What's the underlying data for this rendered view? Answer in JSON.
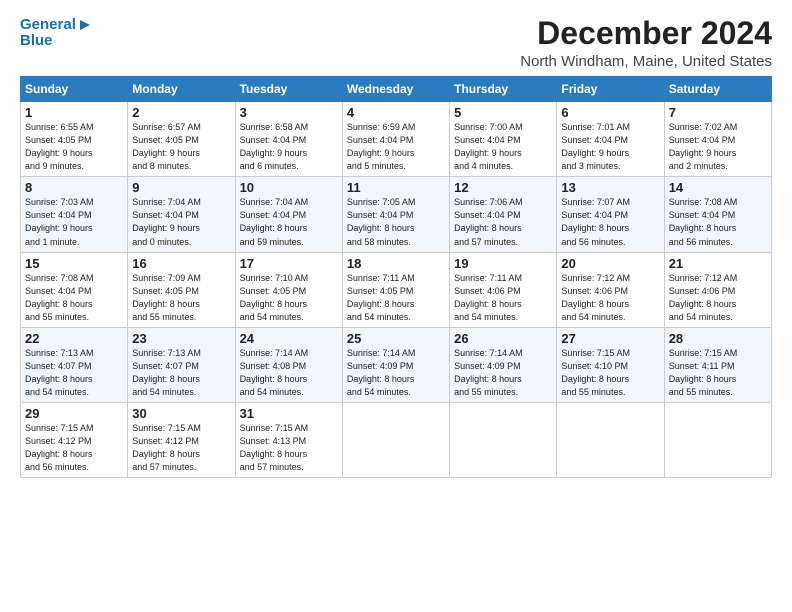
{
  "logo": {
    "line1": "General",
    "line2": "Blue"
  },
  "title": "December 2024",
  "location": "North Windham, Maine, United States",
  "days_of_week": [
    "Sunday",
    "Monday",
    "Tuesday",
    "Wednesday",
    "Thursday",
    "Friday",
    "Saturday"
  ],
  "weeks": [
    [
      {
        "day": "1",
        "lines": [
          "Sunrise: 6:55 AM",
          "Sunset: 4:05 PM",
          "Daylight: 9 hours",
          "and 9 minutes."
        ]
      },
      {
        "day": "2",
        "lines": [
          "Sunrise: 6:57 AM",
          "Sunset: 4:05 PM",
          "Daylight: 9 hours",
          "and 8 minutes."
        ]
      },
      {
        "day": "3",
        "lines": [
          "Sunrise: 6:58 AM",
          "Sunset: 4:04 PM",
          "Daylight: 9 hours",
          "and 6 minutes."
        ]
      },
      {
        "day": "4",
        "lines": [
          "Sunrise: 6:59 AM",
          "Sunset: 4:04 PM",
          "Daylight: 9 hours",
          "and 5 minutes."
        ]
      },
      {
        "day": "5",
        "lines": [
          "Sunrise: 7:00 AM",
          "Sunset: 4:04 PM",
          "Daylight: 9 hours",
          "and 4 minutes."
        ]
      },
      {
        "day": "6",
        "lines": [
          "Sunrise: 7:01 AM",
          "Sunset: 4:04 PM",
          "Daylight: 9 hours",
          "and 3 minutes."
        ]
      },
      {
        "day": "7",
        "lines": [
          "Sunrise: 7:02 AM",
          "Sunset: 4:04 PM",
          "Daylight: 9 hours",
          "and 2 minutes."
        ]
      }
    ],
    [
      {
        "day": "8",
        "lines": [
          "Sunrise: 7:03 AM",
          "Sunset: 4:04 PM",
          "Daylight: 9 hours",
          "and 1 minute."
        ]
      },
      {
        "day": "9",
        "lines": [
          "Sunrise: 7:04 AM",
          "Sunset: 4:04 PM",
          "Daylight: 9 hours",
          "and 0 minutes."
        ]
      },
      {
        "day": "10",
        "lines": [
          "Sunrise: 7:04 AM",
          "Sunset: 4:04 PM",
          "Daylight: 8 hours",
          "and 59 minutes."
        ]
      },
      {
        "day": "11",
        "lines": [
          "Sunrise: 7:05 AM",
          "Sunset: 4:04 PM",
          "Daylight: 8 hours",
          "and 58 minutes."
        ]
      },
      {
        "day": "12",
        "lines": [
          "Sunrise: 7:06 AM",
          "Sunset: 4:04 PM",
          "Daylight: 8 hours",
          "and 57 minutes."
        ]
      },
      {
        "day": "13",
        "lines": [
          "Sunrise: 7:07 AM",
          "Sunset: 4:04 PM",
          "Daylight: 8 hours",
          "and 56 minutes."
        ]
      },
      {
        "day": "14",
        "lines": [
          "Sunrise: 7:08 AM",
          "Sunset: 4:04 PM",
          "Daylight: 8 hours",
          "and 56 minutes."
        ]
      }
    ],
    [
      {
        "day": "15",
        "lines": [
          "Sunrise: 7:08 AM",
          "Sunset: 4:04 PM",
          "Daylight: 8 hours",
          "and 55 minutes."
        ]
      },
      {
        "day": "16",
        "lines": [
          "Sunrise: 7:09 AM",
          "Sunset: 4:05 PM",
          "Daylight: 8 hours",
          "and 55 minutes."
        ]
      },
      {
        "day": "17",
        "lines": [
          "Sunrise: 7:10 AM",
          "Sunset: 4:05 PM",
          "Daylight: 8 hours",
          "and 54 minutes."
        ]
      },
      {
        "day": "18",
        "lines": [
          "Sunrise: 7:11 AM",
          "Sunset: 4:05 PM",
          "Daylight: 8 hours",
          "and 54 minutes."
        ]
      },
      {
        "day": "19",
        "lines": [
          "Sunrise: 7:11 AM",
          "Sunset: 4:06 PM",
          "Daylight: 8 hours",
          "and 54 minutes."
        ]
      },
      {
        "day": "20",
        "lines": [
          "Sunrise: 7:12 AM",
          "Sunset: 4:06 PM",
          "Daylight: 8 hours",
          "and 54 minutes."
        ]
      },
      {
        "day": "21",
        "lines": [
          "Sunrise: 7:12 AM",
          "Sunset: 4:06 PM",
          "Daylight: 8 hours",
          "and 54 minutes."
        ]
      }
    ],
    [
      {
        "day": "22",
        "lines": [
          "Sunrise: 7:13 AM",
          "Sunset: 4:07 PM",
          "Daylight: 8 hours",
          "and 54 minutes."
        ]
      },
      {
        "day": "23",
        "lines": [
          "Sunrise: 7:13 AM",
          "Sunset: 4:07 PM",
          "Daylight: 8 hours",
          "and 54 minutes."
        ]
      },
      {
        "day": "24",
        "lines": [
          "Sunrise: 7:14 AM",
          "Sunset: 4:08 PM",
          "Daylight: 8 hours",
          "and 54 minutes."
        ]
      },
      {
        "day": "25",
        "lines": [
          "Sunrise: 7:14 AM",
          "Sunset: 4:09 PM",
          "Daylight: 8 hours",
          "and 54 minutes."
        ]
      },
      {
        "day": "26",
        "lines": [
          "Sunrise: 7:14 AM",
          "Sunset: 4:09 PM",
          "Daylight: 8 hours",
          "and 55 minutes."
        ]
      },
      {
        "day": "27",
        "lines": [
          "Sunrise: 7:15 AM",
          "Sunset: 4:10 PM",
          "Daylight: 8 hours",
          "and 55 minutes."
        ]
      },
      {
        "day": "28",
        "lines": [
          "Sunrise: 7:15 AM",
          "Sunset: 4:11 PM",
          "Daylight: 8 hours",
          "and 55 minutes."
        ]
      }
    ],
    [
      {
        "day": "29",
        "lines": [
          "Sunrise: 7:15 AM",
          "Sunset: 4:12 PM",
          "Daylight: 8 hours",
          "and 56 minutes."
        ]
      },
      {
        "day": "30",
        "lines": [
          "Sunrise: 7:15 AM",
          "Sunset: 4:12 PM",
          "Daylight: 8 hours",
          "and 57 minutes."
        ]
      },
      {
        "day": "31",
        "lines": [
          "Sunrise: 7:15 AM",
          "Sunset: 4:13 PM",
          "Daylight: 8 hours",
          "and 57 minutes."
        ]
      },
      null,
      null,
      null,
      null
    ]
  ]
}
